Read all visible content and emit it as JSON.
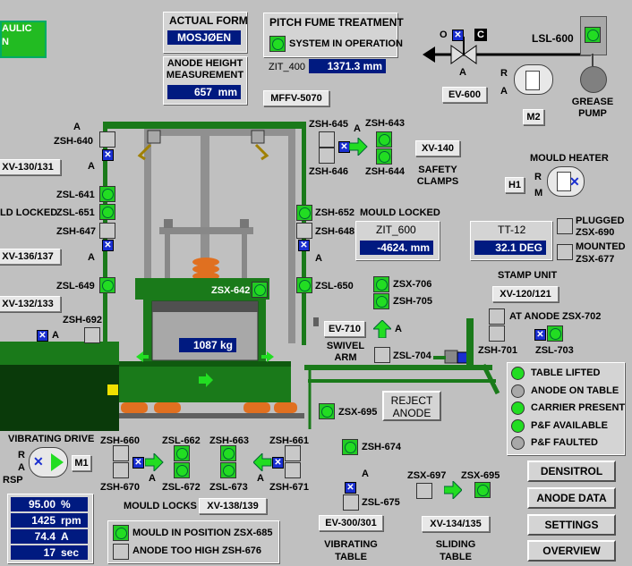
{
  "header": {
    "hydraulic_label": "AULIC\nN",
    "actual_form_title": "ACTUAL FORM",
    "actual_form_value": "MOSJØEN",
    "anode_height_title": "ANODE HEIGHT MEASUREMENT",
    "anode_height_value": "657",
    "anode_height_unit": "mm",
    "pitch_fume_title": "PITCH FUME TREATMENT",
    "system_label": "SYSTEM IN OPERATION",
    "zit400_label": "ZIT_400",
    "zit400_value": "1371.3",
    "zit400_unit": "mm",
    "mffv_label": "MFFV-5070"
  },
  "valve": {
    "o_label": "O",
    "c_label": "C",
    "a_label": "A",
    "tag": "EV-600",
    "lsl_label": "LSL-600",
    "r_label": "R",
    "a2_label": "A",
    "m2_label": "M2",
    "pump_label": "GREASE PUMP"
  },
  "left": {
    "a_top": "A",
    "zsh640": "ZSH-640",
    "xv130": "XV-130/131",
    "a_mid": "A",
    "zsl641": "ZSL-641",
    "ld_locked": "LD LOCKED",
    "zsl651": "ZSL-651",
    "zsh647": "ZSH-647",
    "xv136": "XV-136/137",
    "a_low": "A",
    "zsl649": "ZSL-649",
    "xv132": "XV-132/133",
    "zsh692": "ZSH-692",
    "a_x": "A"
  },
  "center": {
    "zsh645": "ZSH-645",
    "zsh646": "ZSH-646",
    "a_arrow": "A",
    "zsh643": "ZSH-643",
    "zsh644": "ZSH-644",
    "xv140": "XV-140",
    "safety_clamps": "SAFETY CLAMPS",
    "zsh652": "ZSH-652",
    "zsh648": "ZSH-648",
    "a_right": "A",
    "zsl650": "ZSL-650",
    "zsx642": "ZSX-642",
    "mould_locked": "MOULD LOCKED",
    "zit600_title": "ZIT_600",
    "zit600_value": "-4624.",
    "zit600_unit": "mm",
    "weight_value": "1087",
    "weight_unit": "kg",
    "zsx706": "ZSX-706",
    "zsh705": "ZSH-705",
    "ev710": "EV-710",
    "a_ev710": "A",
    "swivel_arm": "SWIVEL ARM",
    "zsl704": "ZSL-704",
    "zsx695": "ZSX-695",
    "reject_anode": "REJECT ANODE",
    "zsh674": "ZSH-674"
  },
  "right": {
    "mould_heater": "MOULD HEATER",
    "h1": "H1",
    "r": "R",
    "m": "M",
    "tt12_title": "TT-12",
    "tt12_value": "32.1",
    "tt12_unit": "DEG",
    "plugged": "PLUGGED",
    "zsx690": "ZSX-690",
    "mounted": "MOUNTED",
    "zsx677": "ZSX-677",
    "stamp_unit": "STAMP UNIT",
    "xv120": "XV-120/121",
    "at_anode": "AT ANODE",
    "zsx702": "ZSX-702",
    "zsh701": "ZSH-701",
    "zsl703": "ZSL-703",
    "status_items": [
      {
        "label": "TABLE LIFTED",
        "on": true
      },
      {
        "label": "ANODE ON TABLE",
        "on": false
      },
      {
        "label": "CARRIER PRESENT",
        "on": true
      },
      {
        "label": "P&F AVAILABLE",
        "on": true
      },
      {
        "label": "P&F FAULTED",
        "on": false
      }
    ]
  },
  "bottom": {
    "vib_drive": "VIBRATING DRIVE",
    "r": "R",
    "a": "A",
    "rsp": "RSP",
    "m1": "M1",
    "readouts": [
      {
        "value": "95.00",
        "unit": "%"
      },
      {
        "value": "1425",
        "unit": "rpm"
      },
      {
        "value": "74.4",
        "unit": "A"
      },
      {
        "value": "17",
        "unit": "sec"
      }
    ],
    "zsh660": "ZSH-660",
    "zsh670": "ZSH-670",
    "a1": "A",
    "zsl662": "ZSL-662",
    "zsl672": "ZSL-672",
    "zsh663": "ZSH-663",
    "zsl673": "ZSL-673",
    "zsh661": "ZSH-661",
    "a2": "A",
    "zsh671": "ZSH-671",
    "mould_locks": "MOULD LOCKS",
    "xv138": "XV-138/139",
    "mould_in_pos": "MOULD IN POSITION ZSX-685",
    "anode_too_high": "ANODE TOO HIGH  ZSH-676",
    "a_vib": "A",
    "zsl675": "ZSL-675",
    "ev300": "EV-300/301",
    "vib_table": "VIBRATING TABLE",
    "zsx697": "ZSX-697",
    "zsx695b": "ZSX-695",
    "xv134": "XV-134/135",
    "sliding_table": "SLIDING TABLE"
  },
  "nav": {
    "densitrol": "DENSITROL",
    "anode_data": "ANODE DATA",
    "settings": "SETTINGS",
    "overview": "OVERVIEW"
  }
}
